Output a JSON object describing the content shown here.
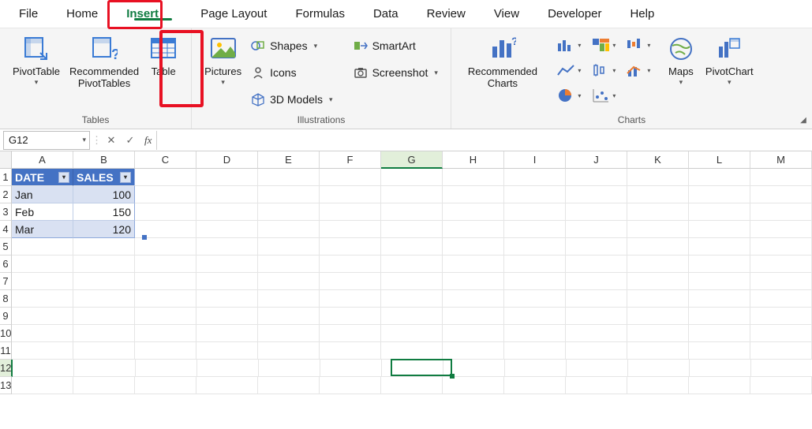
{
  "tabs": {
    "file": "File",
    "home": "Home",
    "insert": "Insert",
    "page_layout": "Page Layout",
    "formulas": "Formulas",
    "data": "Data",
    "review": "Review",
    "view": "View",
    "developer": "Developer",
    "help": "Help",
    "active": "insert"
  },
  "ribbon": {
    "tables": {
      "pivottable": "PivotTable",
      "recommended_pivot": "Recommended\nPivotTables",
      "table": "Table",
      "group_label": "Tables"
    },
    "illustrations": {
      "pictures": "Pictures",
      "shapes": "Shapes",
      "icons": "Icons",
      "models3d": "3D Models",
      "smartart": "SmartArt",
      "screenshot": "Screenshot",
      "group_label": "Illustrations"
    },
    "charts": {
      "recommended": "Recommended\nCharts",
      "maps": "Maps",
      "pivotchart": "PivotChart",
      "group_label": "Charts"
    }
  },
  "formula_bar": {
    "name_box": "G12",
    "fx": "fx",
    "value": ""
  },
  "columns": [
    "A",
    "B",
    "C",
    "D",
    "E",
    "F",
    "G",
    "H",
    "I",
    "J",
    "K",
    "L",
    "M"
  ],
  "rows": [
    "1",
    "2",
    "3",
    "4",
    "5",
    "6",
    "7",
    "8",
    "9",
    "10",
    "11",
    "12",
    "13"
  ],
  "table": {
    "headers": [
      "DATE",
      "SALES"
    ],
    "data": [
      {
        "date": "Jan",
        "sales": "100"
      },
      {
        "date": "Feb",
        "sales": "150"
      },
      {
        "date": "Mar",
        "sales": "120"
      }
    ]
  },
  "active_cell": "G12",
  "highlight_colors": {
    "red": "#e81123"
  }
}
